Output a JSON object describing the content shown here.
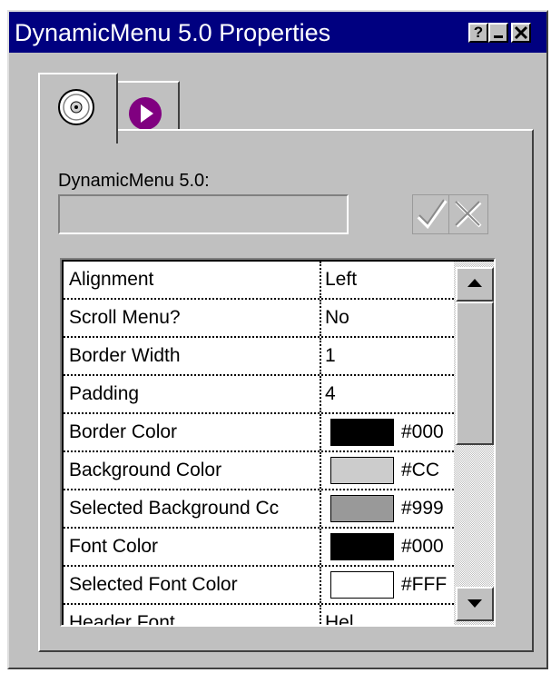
{
  "window": {
    "title": "DynamicMenu 5.0 Properties",
    "buttons": {
      "help": "?",
      "minimize": "_",
      "close": "×"
    }
  },
  "tabs": [
    {
      "icon": "cd-disc-icon"
    },
    {
      "icon": "purple-play-icon"
    }
  ],
  "panel": {
    "label": "DynamicMenu 5.0:",
    "value": "",
    "ok_icon": "check-icon",
    "cancel_icon": "x-icon"
  },
  "properties": [
    {
      "name": "Alignment",
      "value": "Left"
    },
    {
      "name": "Scroll Menu?",
      "value": "No"
    },
    {
      "name": "Border Width",
      "value": "1"
    },
    {
      "name": "Padding",
      "value": "4"
    },
    {
      "name": "Border Color",
      "color": "#000000",
      "value": "#000"
    },
    {
      "name": "Background Color",
      "color": "#CCCCCC",
      "value": "#CC"
    },
    {
      "name": "Selected Background Cc",
      "color": "#999999",
      "value": "#999"
    },
    {
      "name": "Font Color",
      "color": "#000000",
      "value": "#000"
    },
    {
      "name": "Selected Font Color",
      "color": "#FFFFFF",
      "value": "#FFF"
    },
    {
      "name": "Header Font",
      "value": "Hel"
    }
  ]
}
